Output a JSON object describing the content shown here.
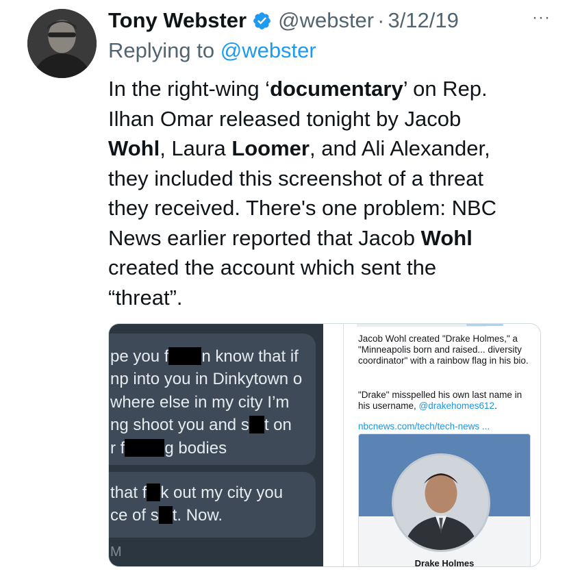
{
  "tweet": {
    "author_name": "Tony Webster",
    "handle": "@webster",
    "separator": "·",
    "date": "3/12/19",
    "more_glyph": "···",
    "replying_prefix": "Replying to ",
    "replying_to": "@webster",
    "text": {
      "l1a": "In the right-wing ‘",
      "l1b": "documentary",
      "l1c": "’ on Rep.",
      "l2": "Ilhan Omar released tonight by Jacob",
      "l3a": "Wohl",
      "l3b": ", Laura ",
      "l3c": "Loomer",
      "l3d": ", and Ali Alexander,",
      "l4": "they included this screenshot of a threat",
      "l5": "they received. There's one problem: NBC",
      "l6a": "News earlier reported that Jacob ",
      "l6b": "Wohl",
      "l7": "created the account which sent the",
      "l8": "“threat”."
    },
    "colors": {
      "link": "#1d9bf0",
      "secondary": "#536471",
      "verified": "#1d9bf0"
    }
  },
  "media_left": {
    "lines": [
      {
        "a": "pe you f",
        "b": "n know that if"
      },
      {
        "a": "np into you in Dinkytown o"
      },
      {
        "a": "where else in my city I’m"
      },
      {
        "a": "ng shoot you and s",
        "b": "t on"
      },
      {
        "a": "r f",
        "b": "g bodies"
      },
      {
        "a": " that f",
        "b": "k out my city you"
      },
      {
        "a": "ce of s",
        "b": "t. Now."
      }
    ],
    "footer_letter": "M"
  },
  "media_right": {
    "para1": "Jacob Wohl created \"Drake Holmes,\" a \"Minneapolis born and raised... diversity coordinator\" with a rainbow flag in his bio.",
    "para2_prefix": "\"Drake\" misspelled his own last name in his username, ",
    "para2_link": "@drakehomes612",
    "para2_suffix": ".",
    "link_text": "nbcnews.com/tech/tech-news   ...",
    "card_name": "Drake Holmes"
  }
}
